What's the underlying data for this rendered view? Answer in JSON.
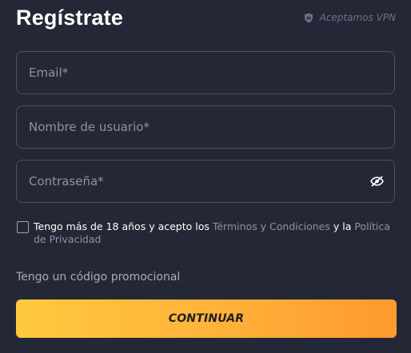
{
  "header": {
    "title": "Regístrate",
    "vpn_label": "Aceptamos VPN",
    "vpn_icon": "shield-icon"
  },
  "form": {
    "email_placeholder": "Email*",
    "username_placeholder": "Nombre de usuario*",
    "password_placeholder": "Contraseña*",
    "email_value": "",
    "username_value": "",
    "password_value": "",
    "password_toggle_icon": "eye-slash-icon"
  },
  "terms": {
    "checked": false,
    "text_before": "Tengo más de 18 años y acepto los ",
    "terms_link": "Términos y Condiciones",
    "text_middle": " y la ",
    "privacy_link": "Política de Privacidad"
  },
  "promo_label": "Tengo un código promocional",
  "submit_label": "CONTINUAR",
  "colors": {
    "background": "#242836",
    "border": "#4a5063",
    "placeholder": "#8d92a4",
    "button_gradient_start": "#ffc93e",
    "button_gradient_end": "#ff9a2e"
  }
}
